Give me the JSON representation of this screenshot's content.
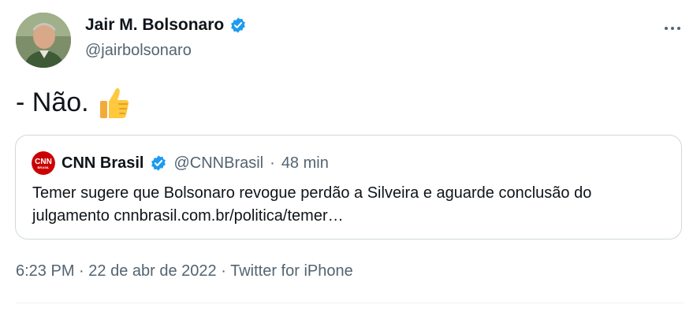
{
  "author": {
    "name": "Jair M. Bolsonaro",
    "handle": "@jairbolsonaro",
    "verified": true
  },
  "tweet": {
    "text": "- Não.",
    "emoji": "thumbs-up-icon"
  },
  "quote": {
    "name": "CNN Brasil",
    "handle": "@CNNBrasil",
    "separator": "·",
    "time": "48 min",
    "text_line1": "Temer sugere que Bolsonaro revogue perdão a Silveira e aguarde conclusão do",
    "text_line2": "julgamento cnnbrasil.com.br/politica/temer…",
    "logo_text": "CNN",
    "logo_subtext": "BRASIL"
  },
  "meta": {
    "time": "6:23 PM",
    "separator": "·",
    "date": "22 de abr de 2022",
    "source": "Twitter for iPhone"
  },
  "colors": {
    "verified": "#1d9bf0",
    "secondary_text": "#536471",
    "primary_text": "#0f1419",
    "border": "#cfd9de",
    "cnn_red": "#cc0000"
  }
}
